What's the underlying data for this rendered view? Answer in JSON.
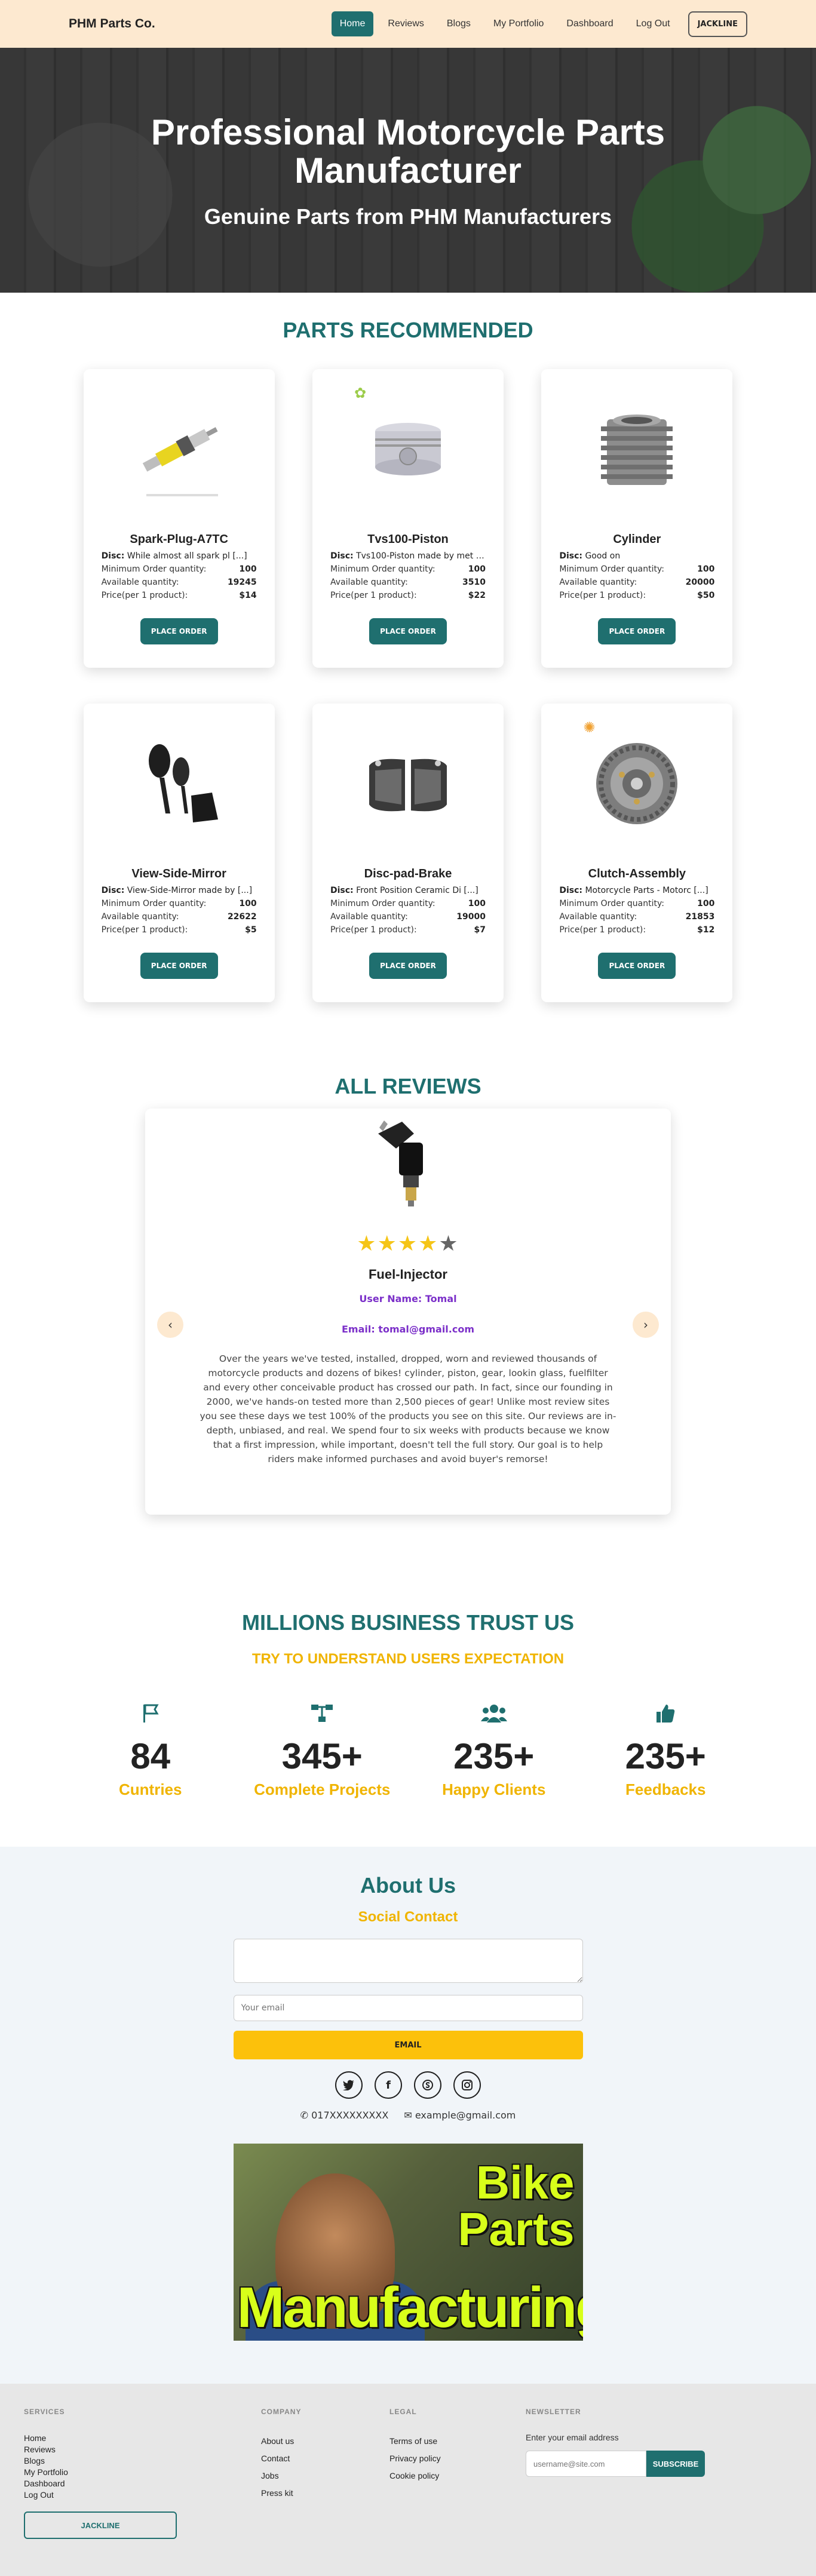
{
  "nav": {
    "brand": "PHM Parts Co.",
    "links": [
      "Home",
      "Reviews",
      "Blogs",
      "My Portfolio",
      "Dashboard",
      "Log Out"
    ],
    "active_link": "Home",
    "user": "JACKLINE"
  },
  "hero": {
    "title": "Professional Motorcycle Parts Manufacturer",
    "subtitle": "Genuine Parts from PHM Manufacturers"
  },
  "parts": {
    "heading": "PARTS RECOMMENDED",
    "desc_label": "Disc:",
    "min_label": "Minimum Order quantity:",
    "avail_label": "Available quantity:",
    "price_label": "Price(per 1 product):",
    "button_label": "PLACE ORDER",
    "items": [
      {
        "name": "Spark-Plug-A7TC",
        "desc": "While almost all spark pl [...]",
        "min": "100",
        "available": "19245",
        "price": "$14"
      },
      {
        "name": "Tvs100-Piston",
        "desc": "Tvs100-Piston made by met [...]",
        "min": "100",
        "available": "3510",
        "price": "$22"
      },
      {
        "name": "Cylinder",
        "desc": "Good on",
        "min": "100",
        "available": "20000",
        "price": "$50"
      },
      {
        "name": "View-Side-Mirror",
        "desc": "View-Side-Mirror made by [...]",
        "min": "100",
        "available": "22622",
        "price": "$5"
      },
      {
        "name": "Disc-pad-Brake",
        "desc": "Front Position Ceramic Di [...]",
        "min": "100",
        "available": "19000",
        "price": "$7"
      },
      {
        "name": "Clutch-Assembly",
        "desc": "Motorcycle Parts - Motorc [...]",
        "min": "100",
        "available": "21853",
        "price": "$12"
      }
    ]
  },
  "reviews": {
    "heading": "ALL REVIEWS",
    "rating": 4,
    "rating_max": 5,
    "product": "Fuel-Injector",
    "user": "User Name: Tomal",
    "email": "Email: tomal@gmail.com",
    "text": "Over the years we've tested, installed, dropped, worn and reviewed thousands of motorcycle products and dozens of bikes! cylinder, piston, gear, lookin glass, fuelfilter and every other conceivable product has crossed our path. In fact, since our founding in 2000, we've hands-on tested more than 2,500 pieces of gear! Unlike most review sites you see these days we test 100% of the products you see on this site. Our reviews are in-depth, unbiased, and real. We spend four to six weeks with products because we know that a first impression, while important, doesn't tell the full story. Our goal is to help riders make informed purchases and avoid buyer's remorse!",
    "prev": "‹",
    "next": "›"
  },
  "trust": {
    "heading": "MILLIONS BUSINESS TRUST US",
    "subheading": "TRY TO UNDERSTAND USERS EXPECTATION",
    "stats": [
      {
        "icon": "flag-icon",
        "value": "84",
        "label": "Cuntries"
      },
      {
        "icon": "sitemap-icon",
        "value": "345+",
        "label": "Complete Projects"
      },
      {
        "icon": "users-icon",
        "value": "235+",
        "label": "Happy Clients"
      },
      {
        "icon": "thumbs-up-icon",
        "value": "235+",
        "label": "Feedbacks"
      }
    ]
  },
  "about": {
    "heading": "About Us",
    "subheading": "Social Contact",
    "email_placeholder": "Your email",
    "button": "EMAIL",
    "phone": "017XXXXXXXXX",
    "contact_email": "example@gmail.com",
    "video_words": [
      "Bike",
      "Parts",
      "Manufacturing"
    ]
  },
  "footer": {
    "services": {
      "title": "SERVICES",
      "links": [
        "Home",
        "Reviews",
        "Blogs",
        "My Portfolio",
        "Dashboard",
        "Log Out"
      ],
      "user": "JACKLINE"
    },
    "company": {
      "title": "COMPANY",
      "links": [
        "About us",
        "Contact",
        "Jobs",
        "Press kit"
      ]
    },
    "legal": {
      "title": "LEGAL",
      "links": [
        "Terms of use",
        "Privacy policy",
        "Cookie policy"
      ]
    },
    "newsletter": {
      "title": "NEWSLETTER",
      "label": "Enter your email address",
      "placeholder": "username@site.com",
      "button": "SUBSCRIBE"
    }
  }
}
